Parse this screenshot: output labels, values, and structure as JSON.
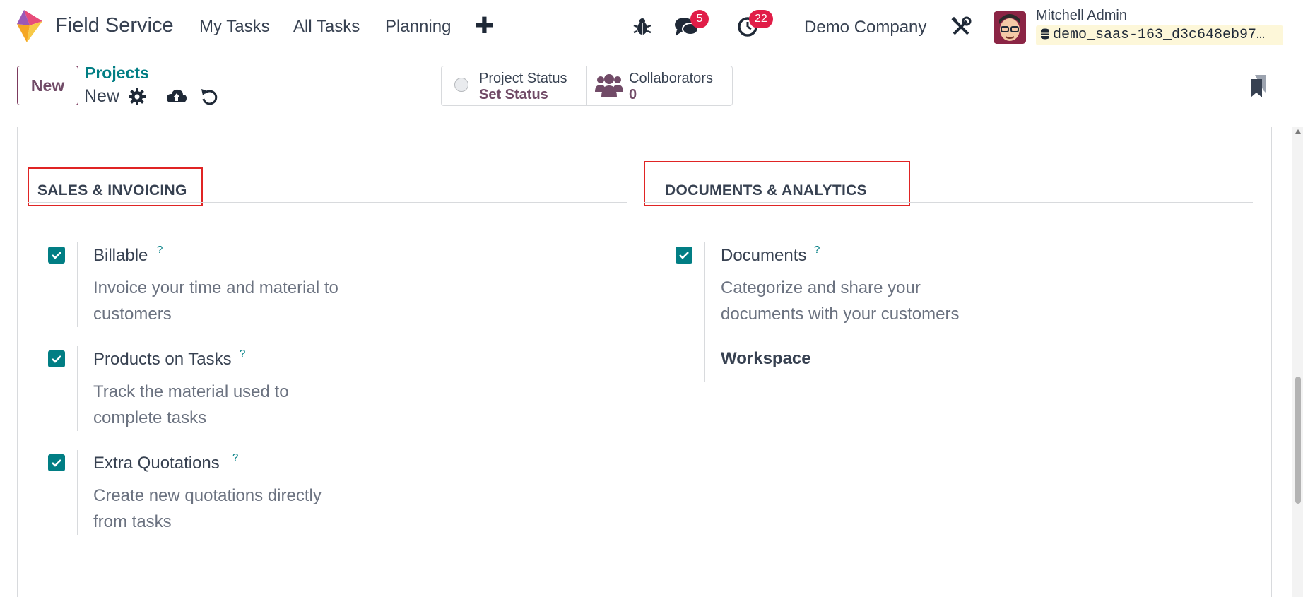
{
  "app": {
    "name": "Field Service"
  },
  "nav": {
    "menu": [
      {
        "label": "My Tasks"
      },
      {
        "label": "All Tasks"
      },
      {
        "label": "Planning"
      }
    ],
    "plus_label": "✚",
    "messages_count": "5",
    "activities_count": "22",
    "company": "Demo Company",
    "user": {
      "name": "Mitchell Admin",
      "database": "demo_saas-163_d3c648eb97…"
    }
  },
  "control_panel": {
    "new_button": "New",
    "breadcrumb": {
      "parent": "Projects",
      "current": "New"
    },
    "smart_buttons": {
      "status": {
        "label": "Project Status",
        "value": "Set Status"
      },
      "collaborators": {
        "label": "Collaborators",
        "value": "0"
      }
    }
  },
  "sections": {
    "sales": {
      "title": "SALES & INVOICING",
      "settings": [
        {
          "title": "Billable",
          "help": "?",
          "description": "Invoice your time and material to customers",
          "checked": true
        },
        {
          "title": "Products on Tasks",
          "help": "?",
          "description": "Track the material used to complete tasks",
          "checked": true
        },
        {
          "title": "Extra Quotations",
          "help": "?",
          "description": "Create new quotations directly from tasks",
          "checked": true
        }
      ]
    },
    "documents": {
      "title": "DOCUMENTS & ANALYTICS",
      "settings": [
        {
          "title": "Documents",
          "help": "?",
          "description": "Categorize and share your documents with your customers",
          "checked": true,
          "extra_label": "Workspace"
        }
      ]
    }
  },
  "colors": {
    "primary": "#714b67",
    "teal": "#017e84",
    "badge": "#e11d48",
    "highlight": "#e02424"
  },
  "icons": [
    "bug-icon",
    "chat-icon",
    "clock-icon",
    "tools-icon",
    "gear-icon",
    "cloud-upload-icon",
    "undo-icon",
    "users-icon",
    "bookmark-icon",
    "database-icon"
  ]
}
